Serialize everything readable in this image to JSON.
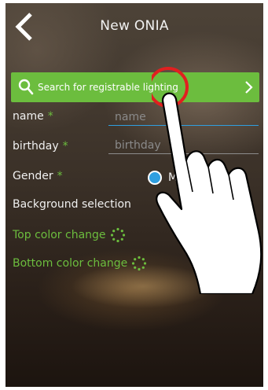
{
  "header": {
    "title": "New ONIA",
    "back_icon": "back-chevron-icon"
  },
  "search": {
    "label": "Search for registrable lighting",
    "icon": "search-icon",
    "chevron": "chevron-right-icon"
  },
  "form": {
    "name": {
      "label": "name",
      "required_mark": "*",
      "placeholder": "name"
    },
    "birthday": {
      "label": "birthday",
      "required_mark": "*",
      "placeholder": "birthday"
    },
    "gender": {
      "label": "Gender",
      "required_mark": "*",
      "selected": "M"
    },
    "background_selection": {
      "label": "Background selection"
    },
    "top_color": {
      "label": "Top color change",
      "icon": "loading-dots-icon"
    },
    "bottom_color": {
      "label": "Bottom color change",
      "icon": "loading-dots-icon"
    }
  },
  "colors": {
    "accent_green": "#6cbd3e",
    "focus_blue": "#2f9fe0",
    "touch_ring": "#e02020"
  }
}
